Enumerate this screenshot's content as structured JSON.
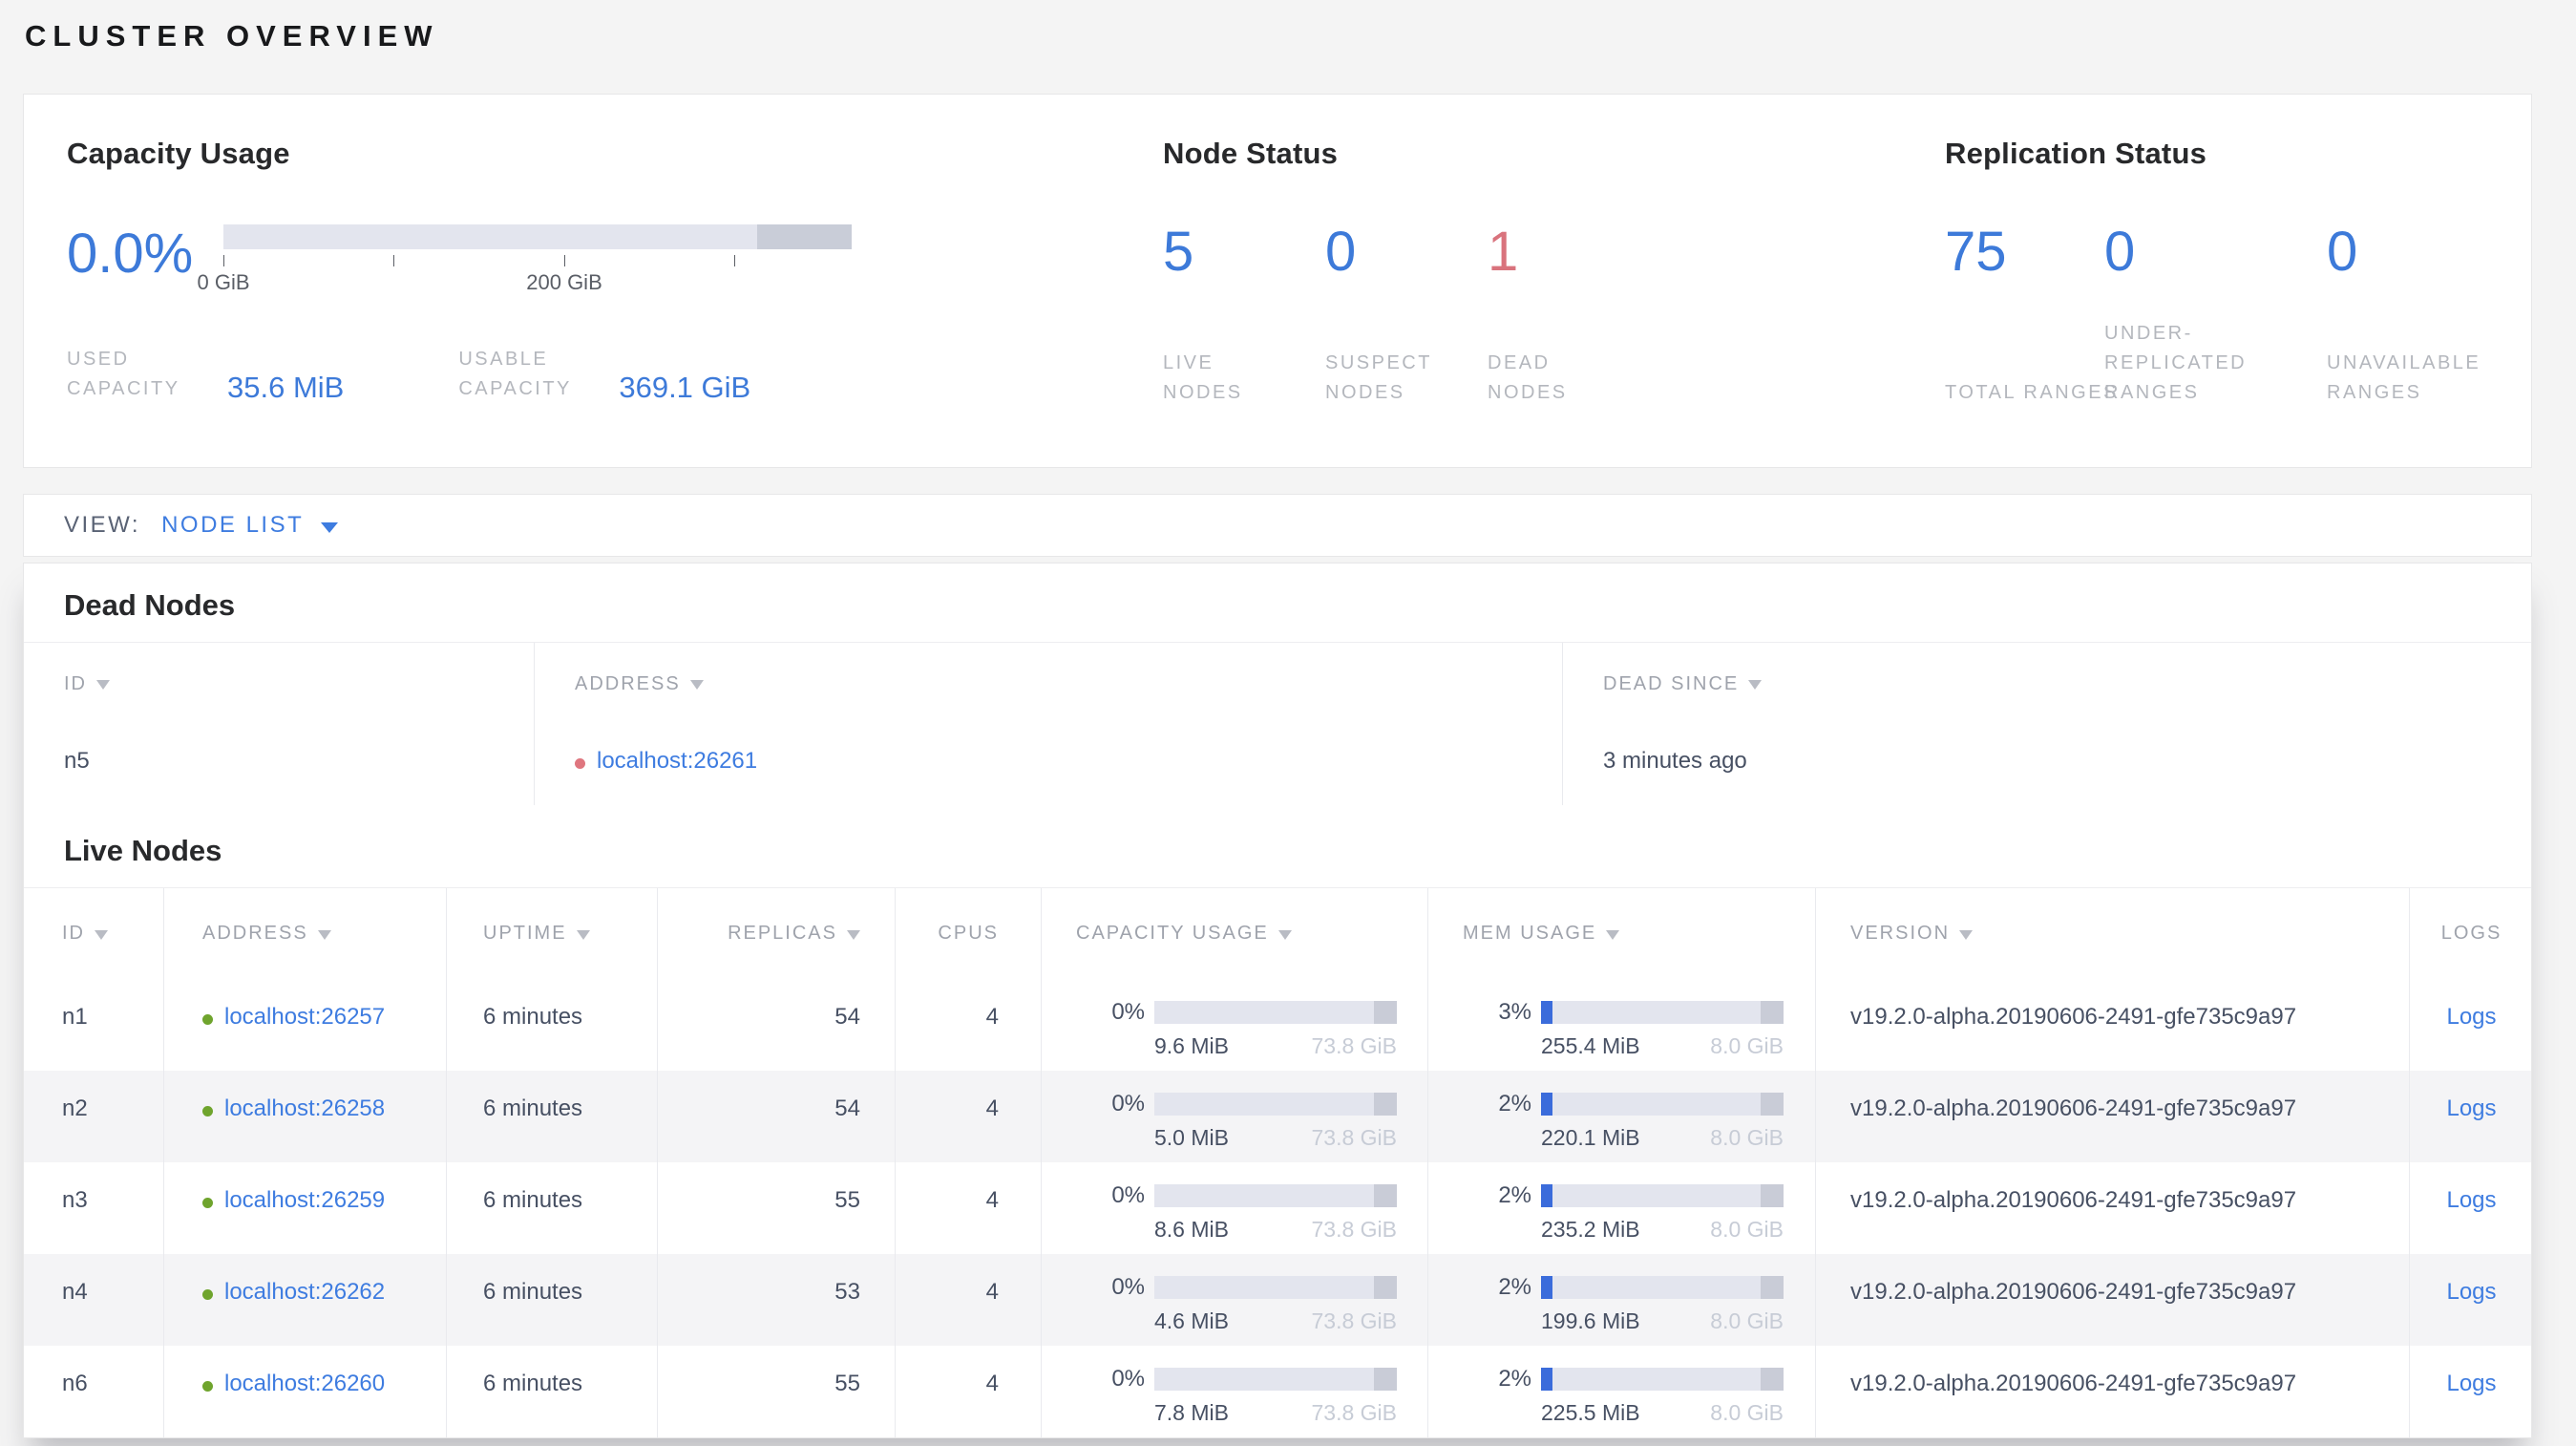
{
  "page_title": "CLUSTER OVERVIEW",
  "colors": {
    "accent_blue": "#3d7ad9",
    "link_blue": "#3e7ce0",
    "danger_red": "#d9737d",
    "live_dot_green": "#6fa42d",
    "dead_dot_red": "#df767f",
    "bar_track": "#e3e5ee",
    "bar_reserved_cap": "#c9ccd7",
    "bar_fill_blue": "#3b6cdb",
    "row_stripe": "#f4f4f6"
  },
  "summary": {
    "capacity": {
      "title": "Capacity Usage",
      "percent": "0.0%",
      "ticks": [
        {
          "label": "0 GiB"
        },
        {
          "label": ""
        },
        {
          "label": "200 GiB"
        },
        {
          "label": ""
        }
      ],
      "used": {
        "label": "USED CAPACITY",
        "value": "35.6 MiB"
      },
      "usable": {
        "label": "USABLE CAPACITY",
        "value": "369.1 GiB"
      }
    },
    "node_status": {
      "title": "Node Status",
      "stats": [
        {
          "value": "5",
          "label": "LIVE NODES",
          "color": "#3d7ad9"
        },
        {
          "value": "0",
          "label": "SUSPECT NODES",
          "color": "#3d7ad9"
        },
        {
          "value": "1",
          "label": "DEAD NODES",
          "color": "#d9737d"
        }
      ]
    },
    "replication": {
      "title": "Replication Status",
      "stats": [
        {
          "value": "75",
          "label": "TOTAL RANGES",
          "color": "#3d7ad9"
        },
        {
          "value": "0",
          "label": "UNDER-REPLICATED RANGES",
          "color": "#3d7ad9"
        },
        {
          "value": "0",
          "label": "UNAVAILABLE RANGES",
          "color": "#3d7ad9"
        }
      ]
    }
  },
  "view_bar": {
    "label": "VIEW:",
    "selected": "NODE LIST"
  },
  "dead_nodes": {
    "title": "Dead Nodes",
    "columns": [
      {
        "label": "ID"
      },
      {
        "label": "ADDRESS"
      },
      {
        "label": "DEAD SINCE"
      }
    ],
    "rows": [
      {
        "id": "n5",
        "address": "localhost:26261",
        "dead_since": "3 minutes ago"
      }
    ]
  },
  "live_nodes": {
    "title": "Live Nodes",
    "columns": [
      {
        "label": "ID"
      },
      {
        "label": "ADDRESS"
      },
      {
        "label": "UPTIME"
      },
      {
        "label": "REPLICAS"
      },
      {
        "label": "CPUS"
      },
      {
        "label": "CAPACITY USAGE"
      },
      {
        "label": "MEM USAGE"
      },
      {
        "label": "VERSION"
      },
      {
        "label": "LOGS"
      }
    ],
    "rows": [
      {
        "id": "n1",
        "address": "localhost:26257",
        "uptime": "6 minutes",
        "replicas": "54",
        "cpus": "4",
        "capacity": {
          "percent": "0%",
          "fill_pct": 0,
          "used": "9.6 MiB",
          "total": "73.8 GiB"
        },
        "memory": {
          "percent": "3%",
          "fill_pct": 3,
          "used": "255.4 MiB",
          "total": "8.0 GiB"
        },
        "version": "v19.2.0-alpha.20190606-2491-gfe735c9a97",
        "logs_label": "Logs"
      },
      {
        "id": "n2",
        "address": "localhost:26258",
        "uptime": "6 minutes",
        "replicas": "54",
        "cpus": "4",
        "capacity": {
          "percent": "0%",
          "fill_pct": 0,
          "used": "5.0 MiB",
          "total": "73.8 GiB"
        },
        "memory": {
          "percent": "2%",
          "fill_pct": 2,
          "used": "220.1 MiB",
          "total": "8.0 GiB"
        },
        "version": "v19.2.0-alpha.20190606-2491-gfe735c9a97",
        "logs_label": "Logs"
      },
      {
        "id": "n3",
        "address": "localhost:26259",
        "uptime": "6 minutes",
        "replicas": "55",
        "cpus": "4",
        "capacity": {
          "percent": "0%",
          "fill_pct": 0,
          "used": "8.6 MiB",
          "total": "73.8 GiB"
        },
        "memory": {
          "percent": "2%",
          "fill_pct": 2,
          "used": "235.2 MiB",
          "total": "8.0 GiB"
        },
        "version": "v19.2.0-alpha.20190606-2491-gfe735c9a97",
        "logs_label": "Logs"
      },
      {
        "id": "n4",
        "address": "localhost:26262",
        "uptime": "6 minutes",
        "replicas": "53",
        "cpus": "4",
        "capacity": {
          "percent": "0%",
          "fill_pct": 0,
          "used": "4.6 MiB",
          "total": "73.8 GiB"
        },
        "memory": {
          "percent": "2%",
          "fill_pct": 2,
          "used": "199.6 MiB",
          "total": "8.0 GiB"
        },
        "version": "v19.2.0-alpha.20190606-2491-gfe735c9a97",
        "logs_label": "Logs"
      },
      {
        "id": "n6",
        "address": "localhost:26260",
        "uptime": "6 minutes",
        "replicas": "55",
        "cpus": "4",
        "capacity": {
          "percent": "0%",
          "fill_pct": 0,
          "used": "7.8 MiB",
          "total": "73.8 GiB"
        },
        "memory": {
          "percent": "2%",
          "fill_pct": 2,
          "used": "225.5 MiB",
          "total": "8.0 GiB"
        },
        "version": "v19.2.0-alpha.20190606-2491-gfe735c9a97",
        "logs_label": "Logs"
      }
    ]
  }
}
